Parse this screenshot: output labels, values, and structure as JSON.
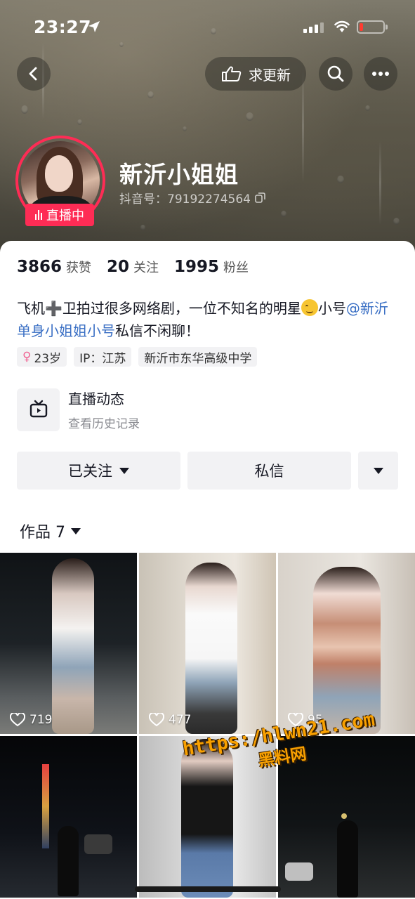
{
  "status_bar": {
    "time": "23:27"
  },
  "header": {
    "update_label": "求更新"
  },
  "profile": {
    "live_badge": "直播中",
    "nickname": "新沂小姐姐",
    "douyin_id": "抖音号：79192274564"
  },
  "stats": [
    {
      "value": "3866",
      "label": "获赞"
    },
    {
      "value": "20",
      "label": "关注"
    },
    {
      "value": "1995",
      "label": "粉丝"
    }
  ],
  "bio": {
    "part1": "飞机",
    "plus": "➕",
    "part2": "卫拍过很多网络剧，一位不知名的明星",
    "part3": "小号",
    "mention": "@新沂单身小姐姐小号",
    "part4": "私信不闲聊！"
  },
  "tags": [
    {
      "icon": "female-icon",
      "label": "23岁"
    },
    {
      "label": "IP：江苏"
    },
    {
      "label": "新沂市东华高级中学"
    }
  ],
  "live_dynamic": {
    "title": "直播动态",
    "subtitle": "查看历史记录"
  },
  "actions": {
    "follow_label": "已关注",
    "message_label": "私信"
  },
  "works_tab": {
    "label": "作品 7"
  },
  "videos": [
    {
      "likes": "719"
    },
    {
      "likes": "477"
    },
    {
      "likes": "95"
    },
    {
      "likes": ""
    },
    {
      "likes": ""
    },
    {
      "likes": ""
    }
  ],
  "watermark": {
    "line1": "https:/hlwn21.com",
    "line2": "黑料网"
  },
  "colors": {
    "accent": "#fe2c55",
    "mention": "#3a6fc4",
    "watermark": "#f8a000"
  }
}
